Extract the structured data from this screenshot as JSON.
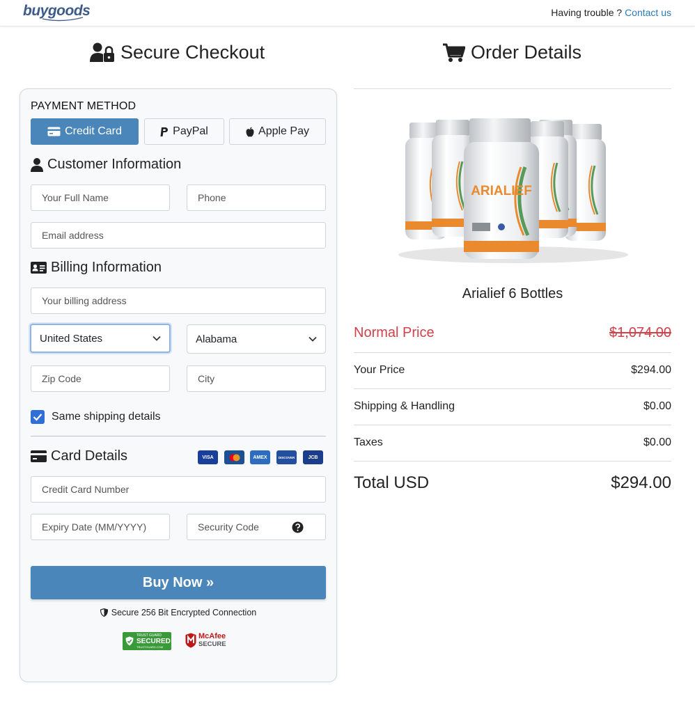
{
  "header": {
    "logo_text": "buygoods",
    "trouble_text": "Having trouble ?",
    "contact_link": "Contact us"
  },
  "checkout": {
    "title": "Secure Checkout",
    "payment_method_label": "PAYMENT METHOD",
    "payment_methods": [
      {
        "label": "Credit Card",
        "active": true
      },
      {
        "label": "PayPal",
        "active": false
      },
      {
        "label": "Apple Pay",
        "active": false
      }
    ],
    "customer_info": {
      "title": "Customer Information",
      "full_name_placeholder": "Your Full Name",
      "phone_placeholder": "Phone",
      "email_placeholder": "Email address"
    },
    "billing_info": {
      "title": "Billing Information",
      "address_placeholder": "Your billing address",
      "country_value": "United States",
      "state_value": "Alabama",
      "zip_placeholder": "Zip Code",
      "city_placeholder": "City",
      "same_shipping_label": "Same shipping details",
      "same_shipping_checked": true
    },
    "card_details": {
      "title": "Card Details",
      "card_logos": [
        "VISA",
        "MC",
        "AMEX",
        "DISCOVER",
        "JCB"
      ],
      "card_number_placeholder": "Credit Card Number",
      "expiry_placeholder": "Expiry Date (MM/YYYY)",
      "security_code_placeholder": "Security Code"
    },
    "buy_button": "Buy Now »",
    "secure_connection": "Secure 256 Bit Encrypted Connection",
    "badges": {
      "trustguard": {
        "line1": "TRUST GUARD",
        "line2": "SECURED",
        "line3": "TRUSTGUARD.COM"
      },
      "mcafee": {
        "line1": "McAfee",
        "line2": "SECURE"
      }
    }
  },
  "order": {
    "title": "Order Details",
    "product_name": "Arialief 6 Bottles",
    "product_brand": "ARIALIEF",
    "normal_price_label": "Normal Price",
    "normal_price_value": "$1,074.00",
    "your_price_label": "Your Price",
    "your_price_value": "$294.00",
    "shipping_label": "Shipping & Handling",
    "shipping_value": "$0.00",
    "taxes_label": "Taxes",
    "taxes_value": "$0.00",
    "total_label": "Total USD",
    "total_value": "$294.00"
  },
  "colors": {
    "primary": "#4a86ba",
    "link": "#2a7ab8",
    "normal_price": "#d0414a",
    "checkbox": "#2f6fd6"
  }
}
